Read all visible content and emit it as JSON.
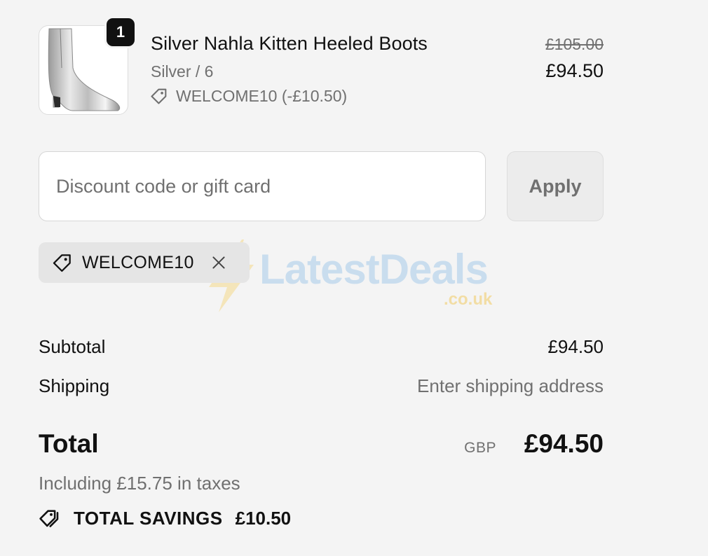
{
  "cart": {
    "item": {
      "quantity": "1",
      "name": "Silver Nahla Kitten Heeled Boots",
      "variant": "Silver / 6",
      "discount_line": "WELCOME10 (-£10.50)",
      "price_original": "£105.00",
      "price_final": "£94.50",
      "image_icon": "silver-boot-image"
    }
  },
  "discount": {
    "placeholder": "Discount code or gift card",
    "value": "",
    "apply_label": "Apply",
    "applied_code": "WELCOME10"
  },
  "watermark": {
    "text": "LatestDeals",
    "sub": ".co.uk"
  },
  "summary": {
    "subtotal_label": "Subtotal",
    "subtotal_value": "£94.50",
    "shipping_label": "Shipping",
    "shipping_value": "Enter shipping address",
    "total_label": "Total",
    "currency": "GBP",
    "total_value": "£94.50",
    "tax_note": "Including £15.75 in taxes",
    "savings_label": "TOTAL SAVINGS",
    "savings_value": "£10.50"
  },
  "colors": {
    "background": "#f4f4f4",
    "text_primary": "#111111",
    "text_muted": "#707070",
    "chip_bg": "#e5e5e5"
  }
}
